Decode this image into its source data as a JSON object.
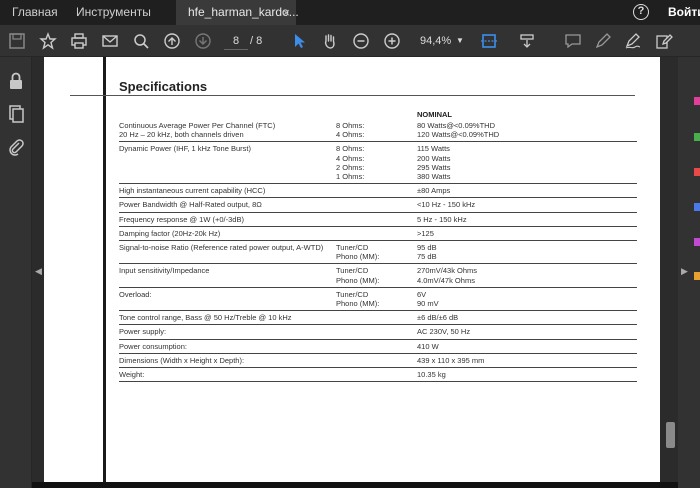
{
  "tabs": {
    "home": "Главная",
    "tools": "Инструменты",
    "doc": "hfe_harman_kardo...",
    "close": "×"
  },
  "header": {
    "help": "?",
    "login": "Войти"
  },
  "toolbar": {
    "page_current": "8",
    "page_total": "/ 8",
    "zoom": "94,4%",
    "zoom_arrow": "▼"
  },
  "nav": {
    "left_arrow": "◀",
    "right_arrow": "▶"
  },
  "accent_colors": [
    "#e0409a",
    "#47b04a",
    "#e84a4a",
    "#4a7ae8",
    "#c04ad0",
    "#e8a030"
  ],
  "doc": {
    "title": "Specifications",
    "nominal": "NOMINAL",
    "rows": [
      {
        "c1": [
          "Continuous Average Power Per Channel (FTC)",
          "20 Hz – 20 kHz, both channels driven"
        ],
        "c2": [
          "8 Ohms:",
          "4 Ohms:"
        ],
        "c3": [
          "80 Watts@<0.09%THD",
          "120 Watts@<0.09%THD"
        ]
      },
      {
        "c1": [
          "Dynamic Power (IHF, 1 kHz Tone Burst)"
        ],
        "c2": [
          "8 Ohms:",
          "4 Ohms:",
          "2 Ohms:",
          "1 Ohms:"
        ],
        "c3": [
          "115 Watts",
          "200 Watts",
          "295 Watts",
          "380 Watts"
        ]
      },
      {
        "c1": [
          "High instantaneous current capability (HCC)"
        ],
        "c2": [],
        "c3": [
          "±80 Amps"
        ]
      },
      {
        "c1": [
          "Power Bandwidth @ Half-Rated output, 8Ω"
        ],
        "c2": [],
        "c3": [
          "<10 Hz - 150 kHz"
        ]
      },
      {
        "c1": [
          "Frequency response @ 1W (+0/-3dB)"
        ],
        "c2": [],
        "c3": [
          "5 Hz - 150 kHz"
        ]
      },
      {
        "c1": [
          "Damping factor (20Hz-20k Hz)"
        ],
        "c2": [],
        "c3": [
          ">125"
        ]
      },
      {
        "c1": [
          "Signal-to-noise Ratio (Reference rated power output, A-WTD)"
        ],
        "c2": [
          "Tuner/CD",
          "Phono (MM):"
        ],
        "c3": [
          "95 dB",
          "75 dB"
        ]
      },
      {
        "c1": [
          "Input sensitivity/Impedance"
        ],
        "c2": [
          "Tuner/CD",
          "Phono (MM):"
        ],
        "c3": [
          "270mV/43k Ohms",
          "4.0mV/47k Ohms"
        ]
      },
      {
        "c1": [
          "Overload:"
        ],
        "c2": [
          "Tuner/CD",
          "Phono (MM):"
        ],
        "c3": [
          "6V",
          "90 mV"
        ]
      },
      {
        "c1": [
          "Tone control range, Bass @ 50 Hz/Treble @ 10 kHz"
        ],
        "c2": [],
        "c3": [
          "±6 dB/±6 dB"
        ]
      },
      {
        "c1": [
          "Power supply:"
        ],
        "c2": [],
        "c3": [
          "AC 230V, 50 Hz"
        ]
      },
      {
        "c1": [
          "Power consumption:"
        ],
        "c2": [],
        "c3": [
          "410 W"
        ]
      },
      {
        "c1": [
          "Dimensions (Width x Height x Depth):"
        ],
        "c2": [],
        "c3": [
          "439 x 110 x 395 mm"
        ]
      },
      {
        "c1": [
          "Weight:"
        ],
        "c2": [],
        "c3": [
          "10.35 kg"
        ]
      }
    ]
  }
}
